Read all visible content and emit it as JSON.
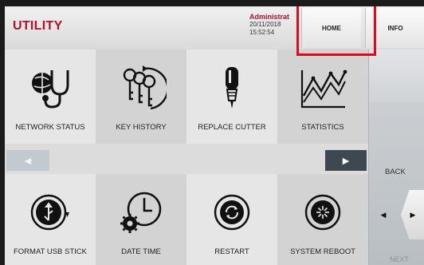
{
  "header": {
    "title": "UTILITY",
    "user": "Administrat",
    "date": "20/11/2018",
    "time": "15:52:54",
    "home_label": "HOME",
    "info_label": "INFO"
  },
  "tiles": [
    {
      "label": "NETWORK STATUS",
      "icon": "network-status-icon"
    },
    {
      "label": "KEY HISTORY",
      "icon": "key-history-icon"
    },
    {
      "label": "REPLACE CUTTER",
      "icon": "replace-cutter-icon"
    },
    {
      "label": "STATISTICS",
      "icon": "statistics-icon"
    },
    {
      "label": "FORMAT USB STICK",
      "icon": "usb-format-icon"
    },
    {
      "label": "DATE TIME",
      "icon": "date-time-icon"
    },
    {
      "label": "RESTART",
      "icon": "restart-icon"
    },
    {
      "label": "SYSTEM REBOOT",
      "icon": "system-reboot-icon"
    }
  ],
  "pager": {
    "prev_glyph": "◀",
    "next_glyph": "▶"
  },
  "right_panel": {
    "back_label": "BACK",
    "left_glyph": "◀",
    "right_glyph": "▶",
    "next_label": "NEXT"
  },
  "colors": {
    "brand_red": "#b0122a",
    "highlight_red": "#e0081d"
  }
}
